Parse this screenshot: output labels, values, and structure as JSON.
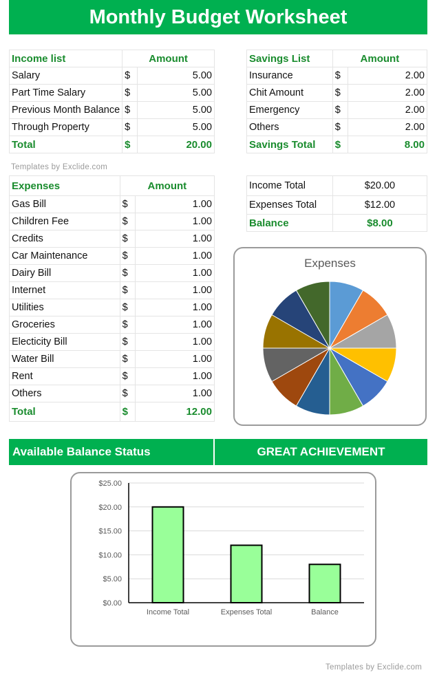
{
  "title": "Monthly Budget Worksheet",
  "watermark": "Templates by Exclide.com",
  "currency_symbol": "$",
  "income": {
    "header_label": "Income list",
    "header_amount": "Amount",
    "rows": [
      {
        "label": "Salary",
        "amount": "5.00"
      },
      {
        "label": "Part Time Salary",
        "amount": "5.00"
      },
      {
        "label": "Previous Month Balance",
        "amount": "5.00"
      },
      {
        "label": "Through Property",
        "amount": "5.00"
      }
    ],
    "total_label": "Total",
    "total_amount": "20.00"
  },
  "savings": {
    "header_label": "Savings List",
    "header_amount": "Amount",
    "rows": [
      {
        "label": "Insurance",
        "amount": "2.00"
      },
      {
        "label": "Chit Amount",
        "amount": "2.00"
      },
      {
        "label": "Emergency",
        "amount": "2.00"
      },
      {
        "label": "Others",
        "amount": "2.00"
      }
    ],
    "total_label": "Savings Total",
    "total_amount": "8.00"
  },
  "expenses": {
    "header_label": "Expenses",
    "header_amount": "Amount",
    "rows": [
      {
        "label": "Gas Bill",
        "amount": "1.00"
      },
      {
        "label": "Children Fee",
        "amount": "1.00"
      },
      {
        "label": "Credits",
        "amount": "1.00"
      },
      {
        "label": "Car Maintenance",
        "amount": "1.00"
      },
      {
        "label": "Dairy Bill",
        "amount": "1.00"
      },
      {
        "label": "Internet",
        "amount": "1.00"
      },
      {
        "label": "Utilities",
        "amount": "1.00"
      },
      {
        "label": "Groceries",
        "amount": "1.00"
      },
      {
        "label": "Electicity Bill",
        "amount": "1.00"
      },
      {
        "label": "Water Bill",
        "amount": "1.00"
      },
      {
        "label": "Rent",
        "amount": "1.00"
      },
      {
        "label": "Others",
        "amount": "1.00"
      }
    ],
    "total_label": "Total",
    "total_amount": "12.00"
  },
  "summary": {
    "rows": [
      {
        "label": "Income Total",
        "value": "$20.00"
      },
      {
        "label": "Expenses Total",
        "value": "$12.00"
      }
    ],
    "balance_label": "Balance",
    "balance_value": "$8.00"
  },
  "status": {
    "label": "Available Balance Status",
    "value": "GREAT ACHIEVEMENT"
  },
  "colors": {
    "brand_green": "#00b050",
    "text_green": "#1a8c2e",
    "bar_fill": "#99ff99",
    "pie": [
      "#5b9bd5",
      "#ed7d31",
      "#a5a5a5",
      "#ffc000",
      "#4472c4",
      "#70ad47",
      "#255e91",
      "#9e480e",
      "#636363",
      "#997300",
      "#264478",
      "#43682b"
    ]
  },
  "chart_data": [
    {
      "type": "pie",
      "title": "Expenses",
      "categories": [
        "Gas Bill",
        "Children Fee",
        "Credits",
        "Car Maintenance",
        "Dairy Bill",
        "Internet",
        "Utilities",
        "Groceries",
        "Electicity Bill",
        "Water Bill",
        "Rent",
        "Others"
      ],
      "values": [
        1,
        1,
        1,
        1,
        1,
        1,
        1,
        1,
        1,
        1,
        1,
        1
      ],
      "legend": "none"
    },
    {
      "type": "bar",
      "title": "",
      "categories": [
        "Income Total",
        "Expenses Total",
        "Balance"
      ],
      "values": [
        20,
        12,
        8
      ],
      "ylim": [
        0,
        25
      ],
      "yticks": [
        "$0.00",
        "$5.00",
        "$10.00",
        "$15.00",
        "$20.00",
        "$25.00"
      ],
      "grid": true
    }
  ]
}
